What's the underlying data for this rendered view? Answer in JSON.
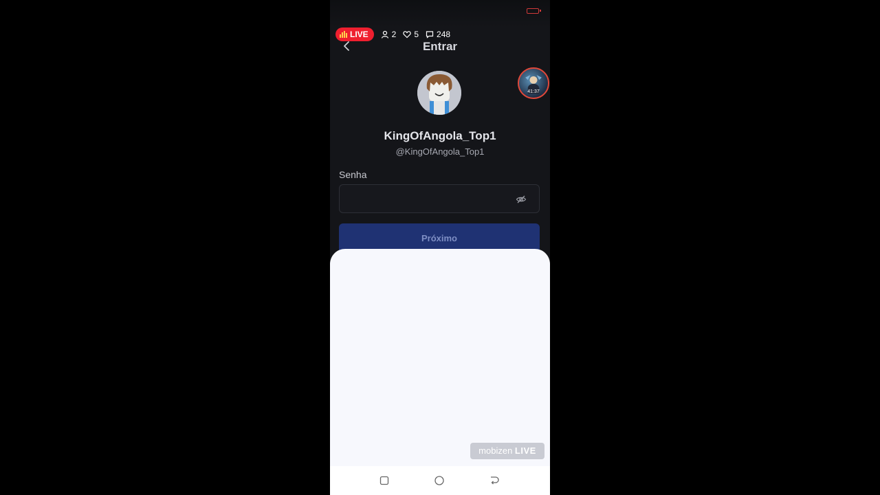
{
  "stream": {
    "live_label": "LIVE",
    "viewers": "2",
    "likes": "5",
    "comments": "248"
  },
  "header": {
    "title": "Entrar"
  },
  "camera_overlay": {
    "timestamp": "41:37"
  },
  "profile": {
    "display_name": "KingOfAngola_Top1",
    "username": "@KingOfAngola_Top1"
  },
  "password": {
    "label": "Senha",
    "value": "",
    "placeholder": ""
  },
  "next_button": {
    "label": "Próximo"
  },
  "watermark": {
    "brand": "mobizen",
    "suffix": "LIVE"
  },
  "icons": {
    "back": "chevron-left-icon",
    "visibility": "eye-off-icon",
    "recent_apps": "square-icon",
    "home": "circle-icon",
    "back_nav": "return-arrow-icon"
  },
  "colors": {
    "live_red": "#ef1f2f",
    "button_blue": "#1f3273",
    "background": "#141519"
  }
}
